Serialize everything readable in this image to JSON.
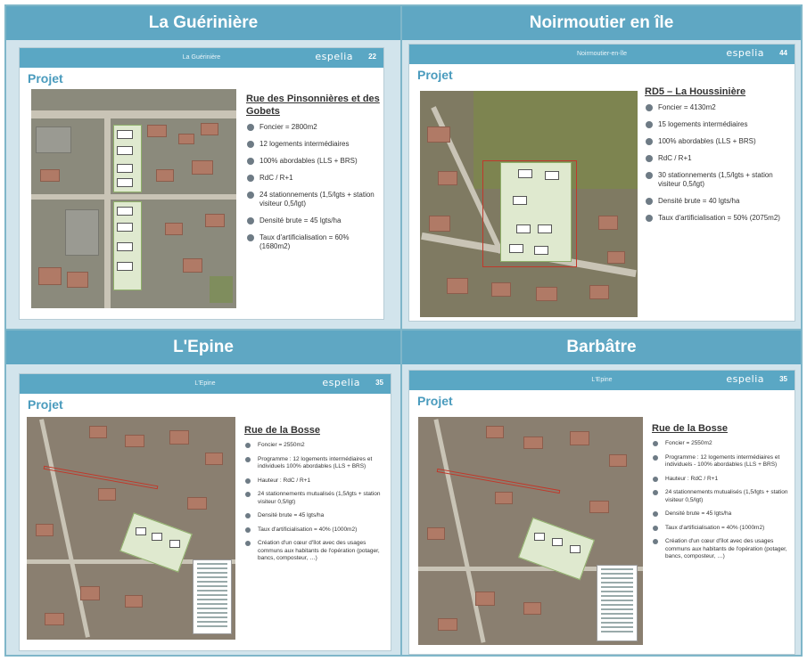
{
  "panels": [
    {
      "header": "La Guérinière",
      "slide_title": "La Guérinière",
      "brand": "espelia",
      "page": "22",
      "projet": "Projet",
      "address": "Rue des Pinsonnières et des Gobets",
      "bullets": [
        "Foncier = 2800m2",
        "12 logements intermédiaires",
        "100% abordables (LLS + BRS)",
        "RdC / R+1",
        "24 stationnements (1,5/lgts + station visiteur 0,5/lgt)",
        "Densité brute = 45 lgts/ha",
        "Taux d'artificialisation = 60% (1680m2)"
      ]
    },
    {
      "header": "Noirmoutier en île",
      "slide_title": "Noirmoutier-en-île",
      "brand": "espelia",
      "page": "44",
      "projet": "Projet",
      "address": "RD5 – La Houssinière",
      "bullets": [
        "Foncier = 4130m2",
        "15 logements intermédiaires",
        "100% abordables (LLS + BRS)",
        "RdC / R+1",
        "30 stationnements (1,5/lgts + station visiteur 0,5/lgt)",
        "Densité brute = 40 lgts/ha",
        "Taux d'artificialisation = 50% (2075m2)"
      ]
    },
    {
      "header": "L'Epine",
      "slide_title": "L'Epine",
      "brand": "espelia",
      "page": "35",
      "projet": "Projet",
      "address": "Rue de la Bosse",
      "bullets": [
        "Foncier = 2550m2",
        "Programme : 12 logements intermédiaires et individuels 100% abordables (LLS + BRS)",
        "Hauteur : RdC / R+1",
        "24 stationnements mutualisés (1,5/lgts + station visiteur 0,5/lgt)",
        "Densité brute = 45 lgts/ha",
        "Taux d'artificialisation = 40% (1000m2)",
        "Création d'un cœur d'îlot avec des usages communs aux habitants de l'opération (potager, bancs, composteur, …)"
      ]
    },
    {
      "header": "Barbâtre",
      "slide_title": "L'Epine",
      "brand": "espelia",
      "page": "35",
      "projet": "Projet",
      "address": "Rue de la Bosse",
      "bullets": [
        "Foncier = 2550m2",
        "Programme : 12 logements intermédiaires et individuels - 100% abordables (LLS + BRS)",
        "Hauteur : RdC / R+1",
        "24 stationnements mutualisés (1,5/lgts + station visiteur 0,5/lgt)",
        "Densité brute = 45 lgts/ha",
        "Taux d'artificialisation = 40% (1000m2)",
        "Création d'un cœur d'îlot avec des usages communs aux habitants de l'opération (potager, bancs, composteur, …)"
      ]
    }
  ]
}
